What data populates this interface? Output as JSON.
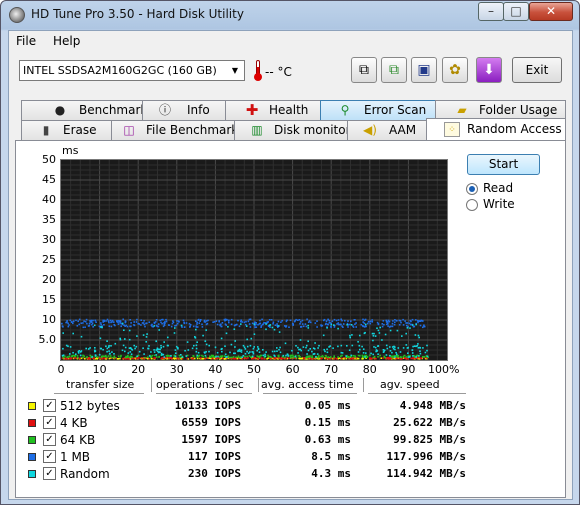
{
  "window": {
    "title": "HD Tune Pro 3.50 - Hard Disk Utility",
    "minimize": "–",
    "maximize": "□",
    "close": "✕"
  },
  "menu": {
    "file": "File",
    "help": "Help"
  },
  "toolbar": {
    "drive": "INTEL SSDSA2M160G2GC (160 GB)",
    "temperature": "-- °C",
    "exit_label": "Exit",
    "icons": [
      "copy-text-icon",
      "copy-screenshot-icon",
      "save-icon",
      "options-icon",
      "download-icon"
    ]
  },
  "tabs": {
    "row1": [
      {
        "label": "Benchmark",
        "icon": "benchmark-icon"
      },
      {
        "label": "Info",
        "icon": "info-icon"
      },
      {
        "label": "Health",
        "icon": "health-icon"
      },
      {
        "label": "Error Scan",
        "icon": "error-scan-icon"
      },
      {
        "label": "Folder Usage",
        "icon": "folder-usage-icon"
      }
    ],
    "row2": [
      {
        "label": "Erase",
        "icon": "erase-icon"
      },
      {
        "label": "File Benchmark",
        "icon": "file-benchmark-icon"
      },
      {
        "label": "Disk monitor",
        "icon": "disk-monitor-icon"
      },
      {
        "label": "AAM",
        "icon": "aam-icon"
      },
      {
        "label": "Random Access",
        "icon": "random-access-icon"
      }
    ],
    "active": "Random Access"
  },
  "controls": {
    "start": "Start",
    "read": "Read",
    "write": "Write",
    "mode": "Read"
  },
  "chart_data": {
    "type": "scatter",
    "ylabel": "ms",
    "ylim": [
      0,
      50
    ],
    "yticks": [
      "50",
      "45",
      "40",
      "35",
      "30",
      "25",
      "20",
      "15",
      "10",
      "5.0"
    ],
    "xticks": [
      "0",
      "10",
      "20",
      "30",
      "40",
      "50",
      "60",
      "70",
      "80",
      "90",
      "100%"
    ],
    "xlim": [
      0,
      100
    ],
    "grid": true,
    "background": "#1a1a1a",
    "series": [
      {
        "name": "512 bytes",
        "color": "#f4f400",
        "band_ms": [
          0.1,
          0.3
        ]
      },
      {
        "name": "4 KB",
        "color": "#e01010",
        "band_ms": [
          0.1,
          0.4
        ]
      },
      {
        "name": "64 KB",
        "color": "#20c020",
        "band_ms": [
          0.4,
          1.0
        ]
      },
      {
        "name": "1 MB",
        "color": "#1e6ee6",
        "band_ms": [
          8,
          10
        ]
      },
      {
        "name": "Random",
        "color": "#10d8e0",
        "band_ms": [
          0.5,
          9
        ]
      }
    ]
  },
  "results": {
    "headers": {
      "size": "transfer size",
      "ops": "operations / sec",
      "access": "avg. access time",
      "speed": "agv. speed"
    },
    "rows": [
      {
        "label": "512 bytes",
        "color": "#f4f400",
        "ops": "10133 IOPS",
        "access": "0.05 ms",
        "speed": "4.948 MB/s"
      },
      {
        "label": "4 KB",
        "color": "#e01010",
        "ops": "6559 IOPS",
        "access": "0.15 ms",
        "speed": "25.622 MB/s"
      },
      {
        "label": "64 KB",
        "color": "#20c020",
        "ops": "1597 IOPS",
        "access": "0.63 ms",
        "speed": "99.825 MB/s"
      },
      {
        "label": "1 MB",
        "color": "#1e6ee6",
        "ops": "117 IOPS",
        "access": "8.5 ms",
        "speed": "117.996 MB/s"
      },
      {
        "label": "Random",
        "color": "#10d8e0",
        "ops": "230 IOPS",
        "access": "4.3 ms",
        "speed": "114.942 MB/s"
      }
    ]
  }
}
